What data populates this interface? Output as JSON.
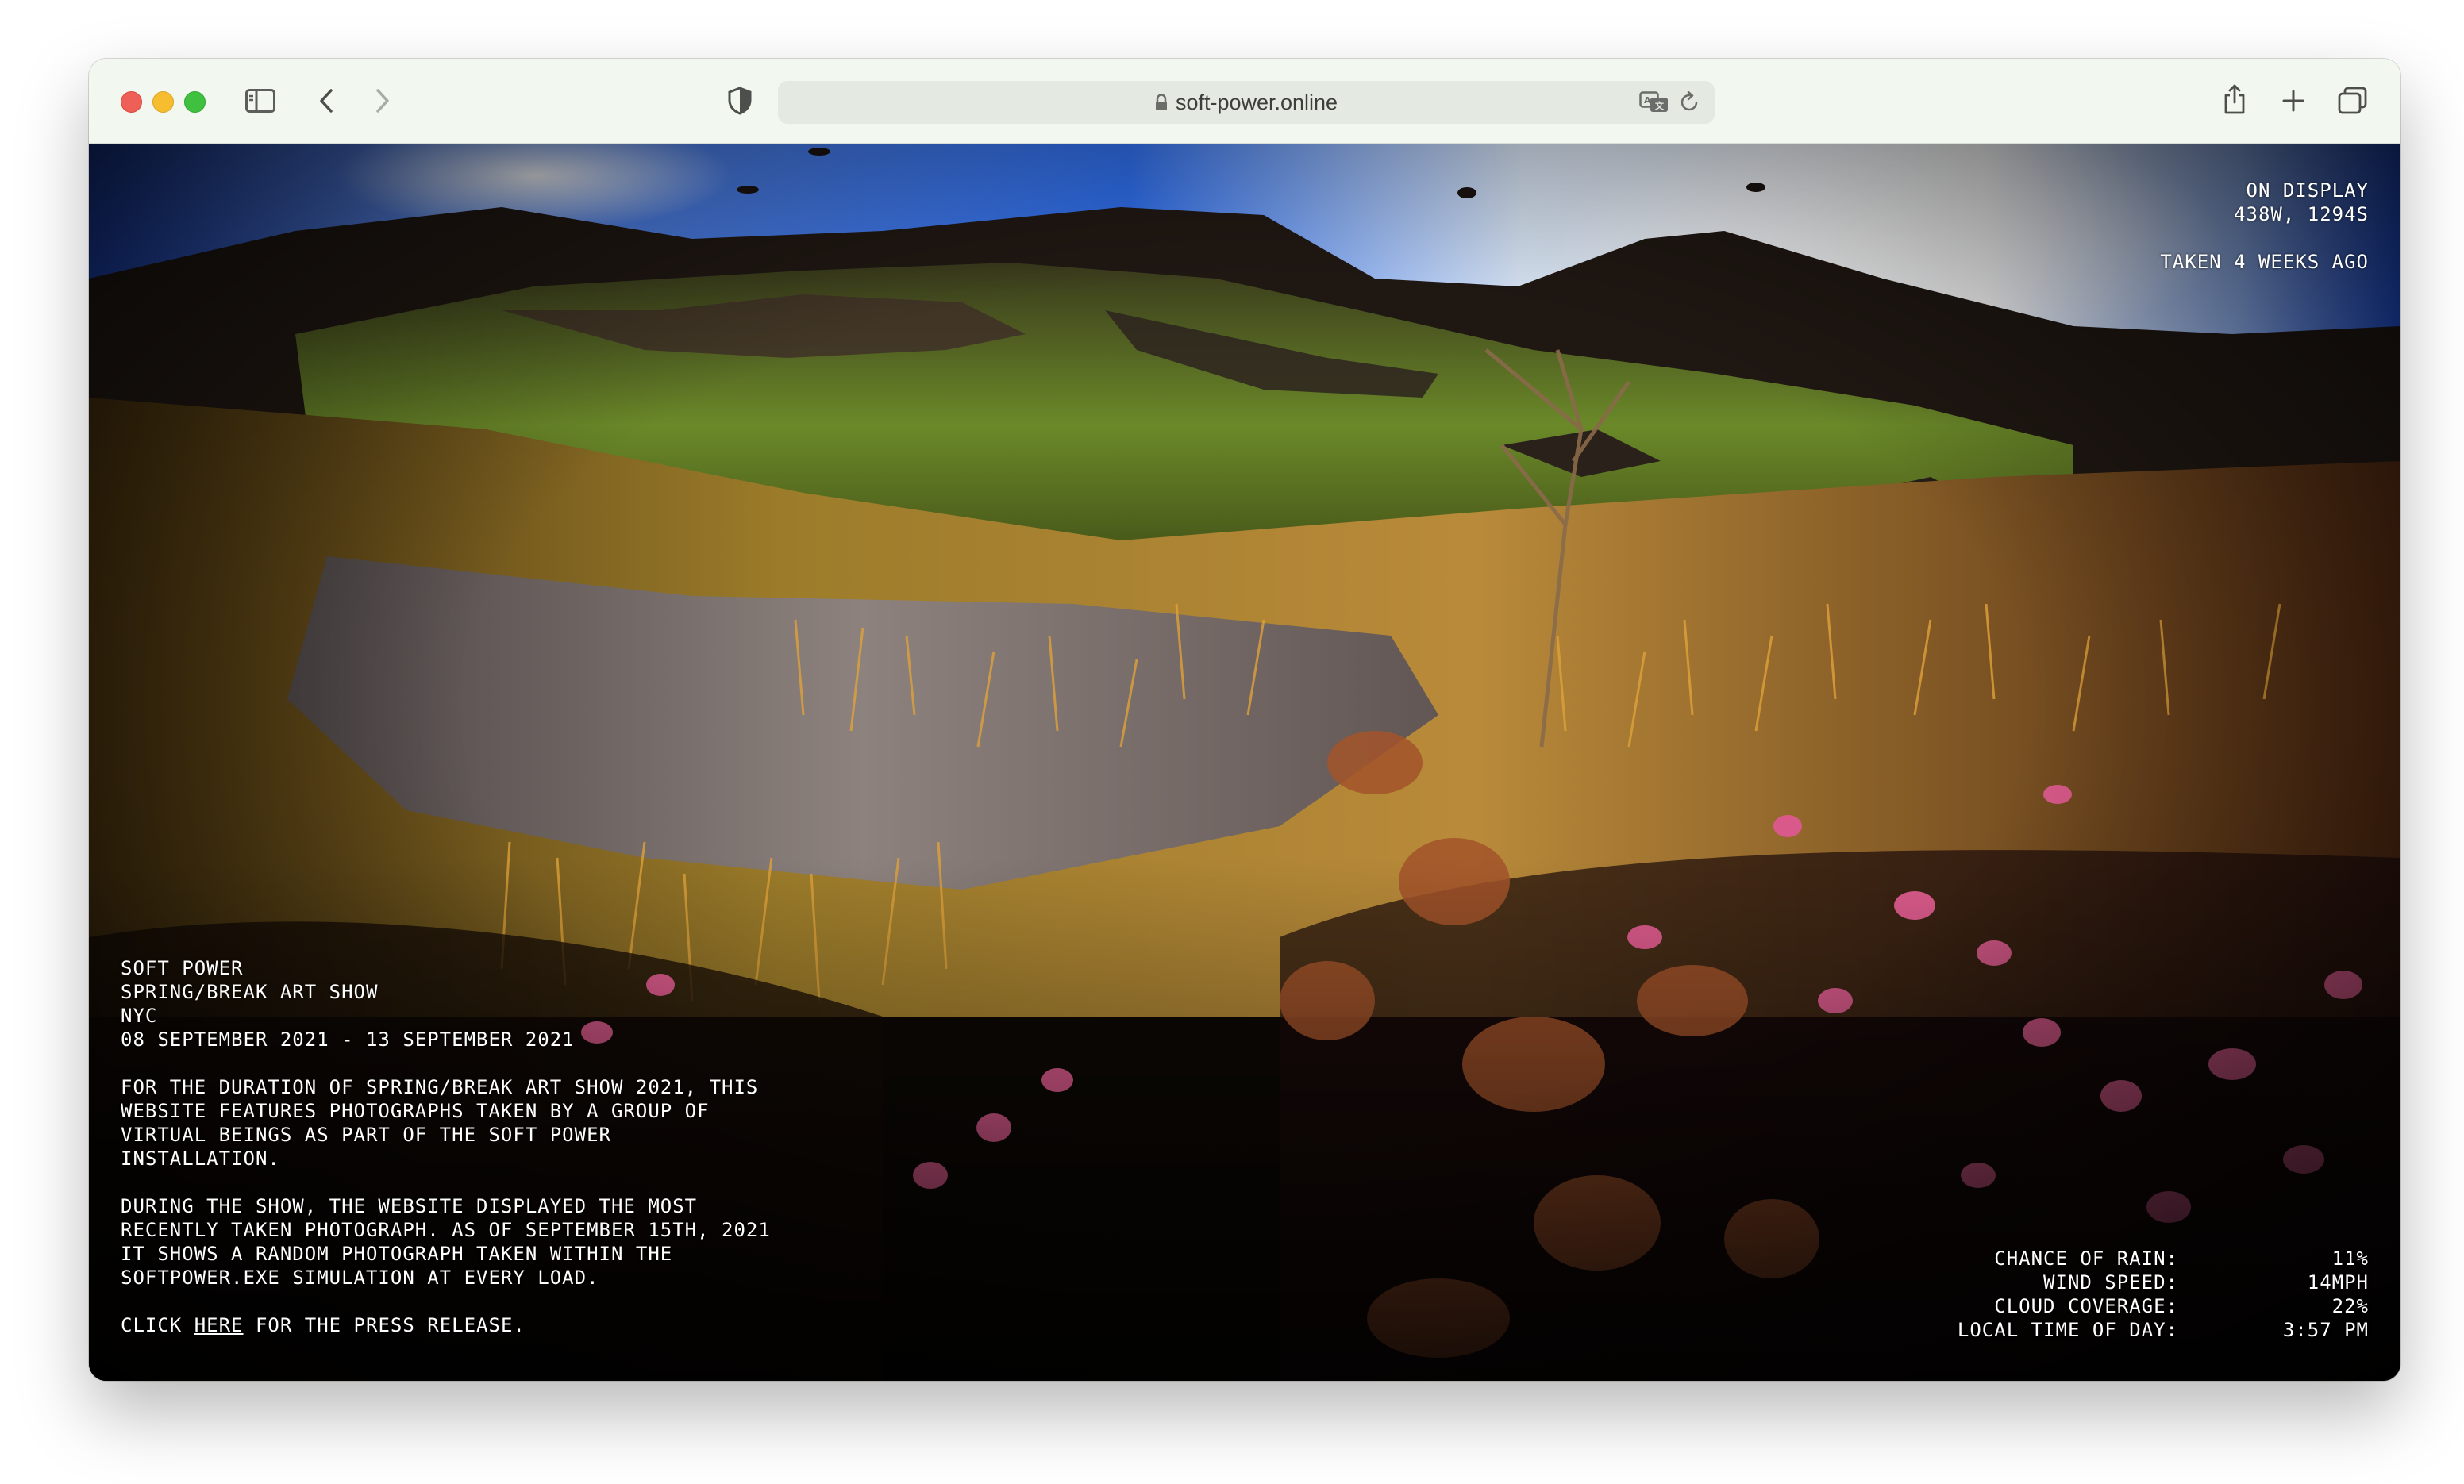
{
  "browser": {
    "url": "soft-power.online",
    "icons": {
      "sidebar": "sidebar-icon",
      "back": "chevron-left-icon",
      "forward": "chevron-right-icon",
      "privacy": "shield-icon",
      "lock": "lock-icon",
      "translate": "translate-icon",
      "reload": "reload-icon",
      "share": "share-icon",
      "new_tab": "plus-icon",
      "tabs": "tabs-overview-icon"
    },
    "colors": {
      "close": "#ee5f57",
      "minimize": "#f6bd2e",
      "zoom": "#3fc13f",
      "toolbar": "#f2f7ef"
    }
  },
  "status": {
    "line1": "ON DISPLAY",
    "line2": "438W, 1294S",
    "line3": "TAKEN 4 WEEKS AGO"
  },
  "info": {
    "title": "SOFT POWER",
    "event": "SPRING/BREAK ART SHOW",
    "city": "NYC",
    "dates": "08 SEPTEMBER 2021 - 13 SEPTEMBER 2021",
    "para1": "FOR THE DURATION OF SPRING/BREAK ART SHOW 2021, THIS WEBSITE FEATURES PHOTOGRAPHS TAKEN BY A GROUP OF VIRTUAL BEINGS AS PART OF THE SOFT POWER INSTALLATION.",
    "para2": "DURING THE SHOW, THE WEBSITE DISPLAYED THE MOST RECENTLY TAKEN PHOTOGRAPH. AS OF SEPTEMBER 15TH, 2021 IT SHOWS A RANDOM PHOTOGRAPH TAKEN WITHIN THE SOFTPOWER.EXE SIMULATION AT EVERY LOAD.",
    "press_prefix": "CLICK",
    "press_link": "HERE",
    "press_suffix": "FOR THE PRESS RELEASE."
  },
  "weather": [
    {
      "label": "CHANCE OF RAIN:",
      "value": "11%"
    },
    {
      "label": "WIND SPEED:",
      "value": "14MPH"
    },
    {
      "label": "CLOUD COVERAGE:",
      "value": "22%"
    },
    {
      "label": "LOCAL TIME OF DAY:",
      "value": "3:57 PM"
    }
  ]
}
